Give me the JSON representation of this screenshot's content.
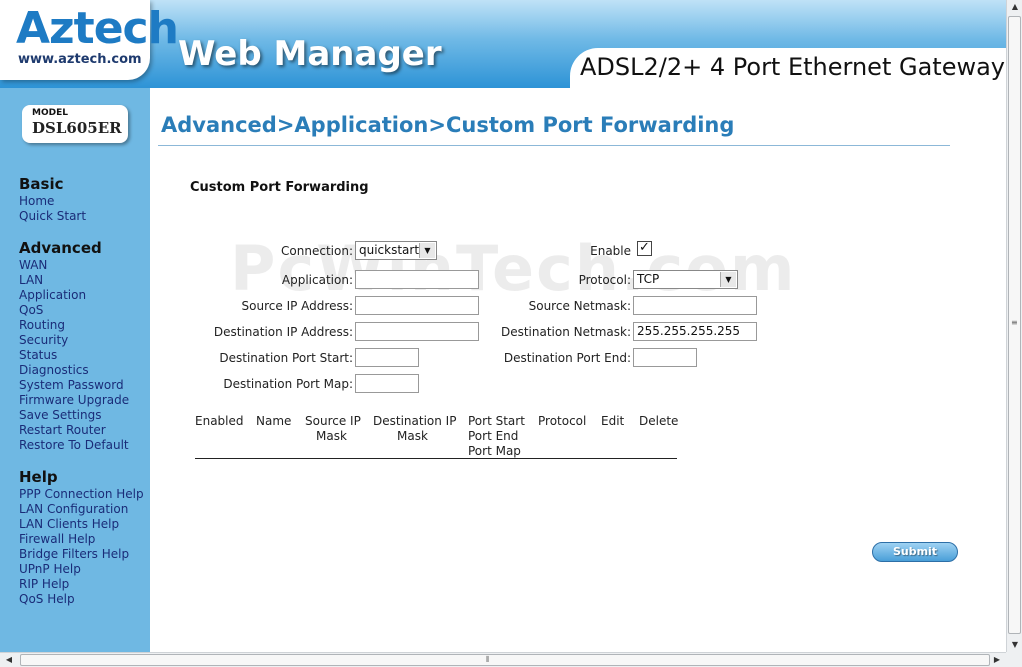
{
  "header": {
    "logo": "Aztech",
    "logo_url": "www.aztech.com",
    "web_manager": "Web Manager",
    "product": "ADSL2/2+ 4 Port Ethernet Gateway"
  },
  "model": {
    "label": "MODEL",
    "name": "DSL605ER"
  },
  "sidebar": {
    "basic": {
      "title": "Basic",
      "items": [
        "Home",
        "Quick Start"
      ]
    },
    "advanced": {
      "title": "Advanced",
      "items": [
        "WAN",
        "LAN",
        "Application",
        "QoS",
        "Routing",
        "Security",
        "Status",
        "Diagnostics",
        "System Password",
        "Firmware Upgrade",
        "Save Settings",
        "Restart Router",
        "Restore To Default"
      ]
    },
    "help": {
      "title": "Help",
      "items": [
        "PPP Connection Help",
        "LAN Configuration",
        "LAN Clients Help",
        "Firewall Help",
        "Bridge Filters Help",
        "UPnP Help",
        "RIP Help",
        "QoS Help"
      ]
    }
  },
  "main": {
    "page_title": "Advanced>Application>Custom Port Forwarding",
    "section_title": "Custom Port Forwarding",
    "watermark": "PcWinTech.com"
  },
  "form": {
    "connection_label": "Connection:",
    "connection_value": "quickstart",
    "enable_label": "Enable",
    "enable_checked": "✓",
    "application_label": "Application:",
    "application_value": "",
    "protocol_label": "Protocol:",
    "protocol_value": "TCP",
    "source_ip_label": "Source IP Address:",
    "source_ip_value": "",
    "source_netmask_label": "Source Netmask:",
    "source_netmask_value": "",
    "dest_ip_label": "Destination IP Address:",
    "dest_ip_value": "",
    "dest_netmask_label": "Destination Netmask:",
    "dest_netmask_value": "255.255.255.255",
    "dest_port_start_label": "Destination Port Start:",
    "dest_port_start_value": "",
    "dest_port_end_label": "Destination Port End:",
    "dest_port_end_value": "",
    "dest_port_map_label": "Destination Port Map:",
    "dest_port_map_value": ""
  },
  "table": {
    "enabled": "Enabled",
    "name": "Name",
    "source_ip_1": "Source IP",
    "source_ip_2": "Mask",
    "dest_ip_1": "Destination IP",
    "dest_ip_2": "Mask",
    "port_1": "Port Start",
    "port_2": "Port End",
    "port_3": "Port Map",
    "protocol": "Protocol",
    "edit": "Edit",
    "delete": "Delete"
  },
  "actions": {
    "submit": "Submit"
  },
  "icons": {
    "dropdown": "chevron-down-icon",
    "checkbox": "checkmark-icon",
    "scroll_up": "arrow-up-icon",
    "scroll_down": "arrow-down-icon",
    "scroll_left": "arrow-left-icon",
    "scroll_right": "arrow-right-icon"
  },
  "colors": {
    "sidebar_bg": "#6fb8e3",
    "title_blue": "#2a7db8",
    "nav_link": "#1a2c78"
  }
}
